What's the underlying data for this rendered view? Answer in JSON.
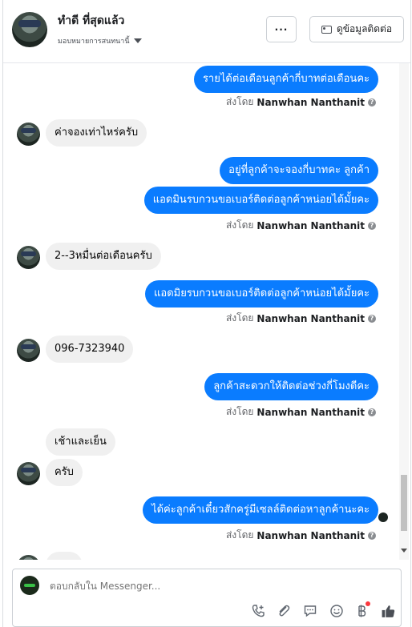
{
  "header": {
    "contact_name": "ทำดี ที่สุดแล้ว",
    "assign_label": "มอบหมายการสนทนานี้",
    "more_label": "···",
    "view_contact_label": "ดูข้อมูลติดต่อ"
  },
  "thread": {
    "messages": [
      {
        "direction": "out",
        "text": "รายได้ต่อเดือนลูกค้ากี่บาทต่อเดือนคะ"
      },
      {
        "direction": "in",
        "text": "ค่าจองเท่าไหร่ครับ"
      },
      {
        "direction": "out",
        "text": "อยู่ที่ลูกค้าจะจองกี่บาทคะ ลูกค้า"
      },
      {
        "direction": "out",
        "text": "แอดมินรบกวนขอเบอร์ติดต่อลูกค้าหน่อยได้มั้ยคะ"
      },
      {
        "direction": "in",
        "text": "2--3หมื่นต่อเดือนครับ"
      },
      {
        "direction": "out",
        "text": "แอดมิยรบกวนขอเบอร์ติดต่อลูกค้าหน่อยได้มั้ยคะ"
      },
      {
        "direction": "in",
        "text": "096-7323940"
      },
      {
        "direction": "out",
        "text": "ลูกค้าสะดวกให้ติดต่อช่วงกี่โมงดีคะ"
      },
      {
        "direction": "in",
        "text": "เช้าและเย็น"
      },
      {
        "direction": "in",
        "text": "ครับ"
      },
      {
        "direction": "out",
        "text": "ได้ค่ะลูกค้าเดี๋ยวสักครู่มีเซลล์ติดต่อหาลูกค้านะคะ"
      }
    ],
    "sent_by_prefix": "ส่งโดย",
    "sent_by_name": "Nanwhan Nanthanit"
  },
  "composer": {
    "placeholder": "ตอบกลับใน Messenger..."
  }
}
